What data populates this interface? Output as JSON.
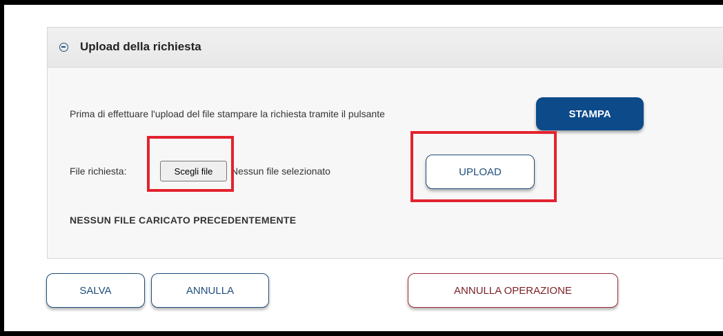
{
  "panel": {
    "title": "Upload della richiesta",
    "collapse_icon": "minus-circle-icon"
  },
  "intro": {
    "text": "Prima di effettuare l'upload del file stampare la richiesta tramite il pulsante",
    "print_button_label": "STAMPA"
  },
  "file_input": {
    "label": "File richiesta:",
    "choose_button_label": "Scegli file",
    "no_file_text": "Nessun file selezionato",
    "upload_button_label": "UPLOAD"
  },
  "status": {
    "text": "NESSUN FILE CARICATO PRECEDENTEMENTE"
  },
  "footer": {
    "save_label": "SALVA",
    "cancel_label": "ANNULLA",
    "cancel_operation_label": "ANNULLA OPERAZIONE"
  },
  "colors": {
    "primary": "#0c4a8a",
    "outline_blue": "#1e4d7b",
    "outline_red": "#9a2a32",
    "highlight": "#e3222e"
  }
}
